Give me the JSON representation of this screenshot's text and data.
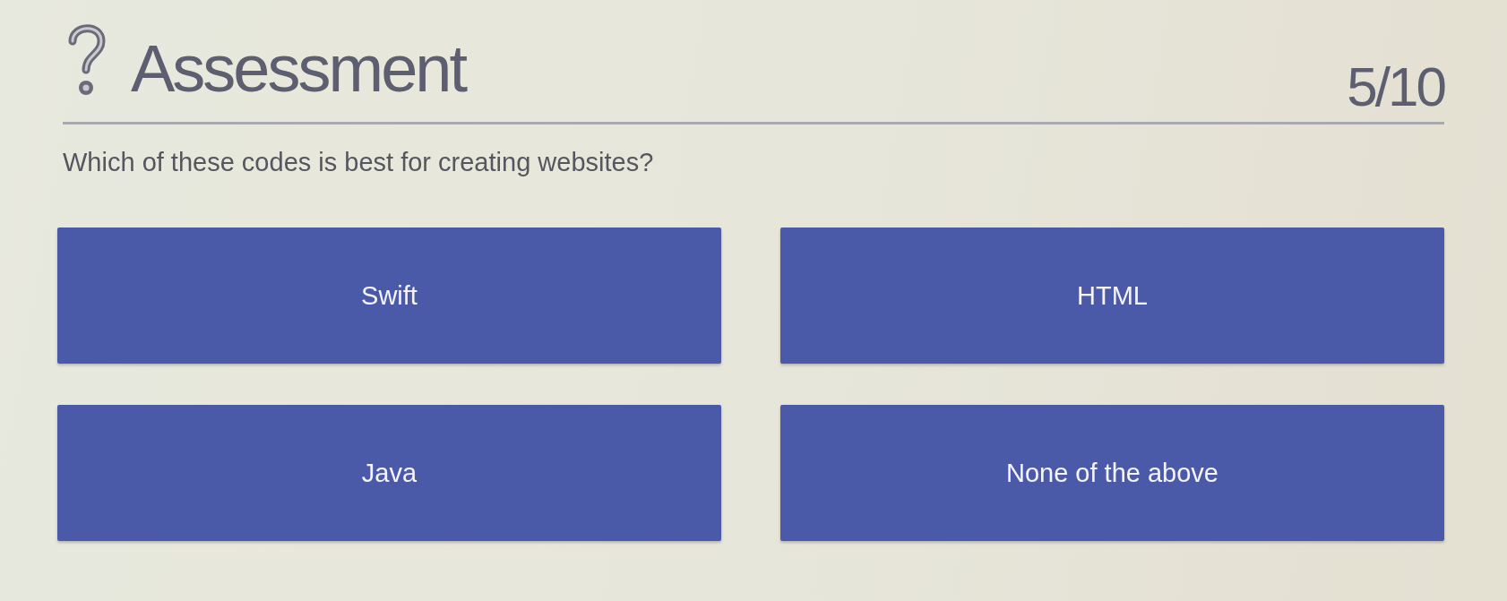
{
  "header": {
    "title": "Assessment",
    "progress": "5/10"
  },
  "question": "Which of these codes is best for creating websites?",
  "answers": [
    {
      "label": "Swift"
    },
    {
      "label": "HTML"
    },
    {
      "label": "Java"
    },
    {
      "label": "None of the above"
    }
  ]
}
